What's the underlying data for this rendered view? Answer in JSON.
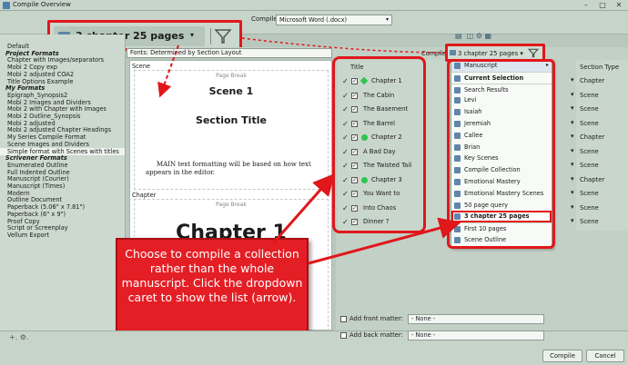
{
  "window": {
    "title": "Compile Overview"
  },
  "top": {
    "compile_for_label": "Compile For:",
    "compile_for_value": "Microsoft Word (.docx)",
    "collection_label": "3 chapter 25 pages",
    "fonts_label": "Fonts: Determined by Section Layout"
  },
  "sidebar": {
    "default": "Default",
    "project_header": "Project Formats",
    "project_items": [
      "Chapter with Images/separators",
      "Mobi 2 Copy exp",
      "Mobi 2 adjusted COA2",
      "Title Options Example"
    ],
    "my_header": "My Formats",
    "my_items": [
      "Epigraph_Synopsis2",
      "Mobi 2  Images and Dividers",
      "Mobi 2  with Chapter with Images",
      "Mobi 2 Outline_Synopsis",
      "Mobi 2 adjusted",
      "Mobi 2 adjusted Chapter Headings",
      "My Series Compile Format",
      "Scene Images and Dividers",
      "Simple format with Scenes with titles"
    ],
    "scrivener_header": "Scrivener Formats",
    "scrivener_items": [
      "Enumerated Outline",
      "Full Indented Outline",
      "Manuscript (Courier)",
      "Manuscript (Times)",
      "Modern",
      "Outline Document",
      "Paperback (5.06\" x 7.81\")",
      "Paperback (6\" x 9\")",
      "Proof Copy",
      "Script or Screenplay",
      "Vellum Export"
    ]
  },
  "preview": {
    "scene_label": "Scene",
    "page_break": "Page Break",
    "scene_heading": "Scene 1",
    "section_title": "Section Title",
    "body_text": "MAIN text formatting will be based on how text appears in the editor.",
    "chapter_label": "Chapter",
    "page_break2": "Page Break",
    "chapter_heading": "Chapter 1"
  },
  "contents": {
    "compile_label": "Compile:",
    "compile_value": "3 chapter 25 pages",
    "title_header": "Title",
    "section_type_header": "Section Type",
    "items": [
      {
        "title": "Chapter 1",
        "type": "Chapter"
      },
      {
        "title": "The Cabin",
        "type": "Scene"
      },
      {
        "title": "The Basement",
        "type": "Scene"
      },
      {
        "title": "The Barrel",
        "type": "Scene"
      },
      {
        "title": "Chapter 2",
        "type": "Chapter"
      },
      {
        "title": "A Bad Day",
        "type": "Scene"
      },
      {
        "title": "The Twisted Tail",
        "type": "Scene"
      },
      {
        "title": "Chapter 3",
        "type": "Chapter"
      },
      {
        "title": "You Want to",
        "type": "Scene"
      },
      {
        "title": "Into Chaos",
        "type": "Scene"
      },
      {
        "title": "Dinner ?",
        "type": "Scene"
      }
    ]
  },
  "dropdown": {
    "items": [
      "Manuscript",
      "Current Selection",
      "Search Results",
      "Levi",
      "Isaiah",
      "Jeremiah",
      "Callee",
      "Brian",
      "Key Scenes",
      "Compile Collection",
      "Emotional Mastery",
      "Emotional Mastery Scenes",
      "50 page query",
      "3 chapter 25 pages",
      "First 10 pages",
      "Scene Outline"
    ]
  },
  "callout": {
    "text": "Choose to compile a collection rather than the whole manuscript. Click the dropdown caret to show the list (arrow)."
  },
  "bottom": {
    "front_matter_label": "Add front matter:",
    "back_matter_label": "Add back matter:",
    "none1": "- None -",
    "none2": "- None -",
    "compile_btn": "Compile",
    "cancel_btn": "Cancel"
  },
  "colors": {
    "accent_red": "#e41e25",
    "green": "#2ec44f"
  }
}
